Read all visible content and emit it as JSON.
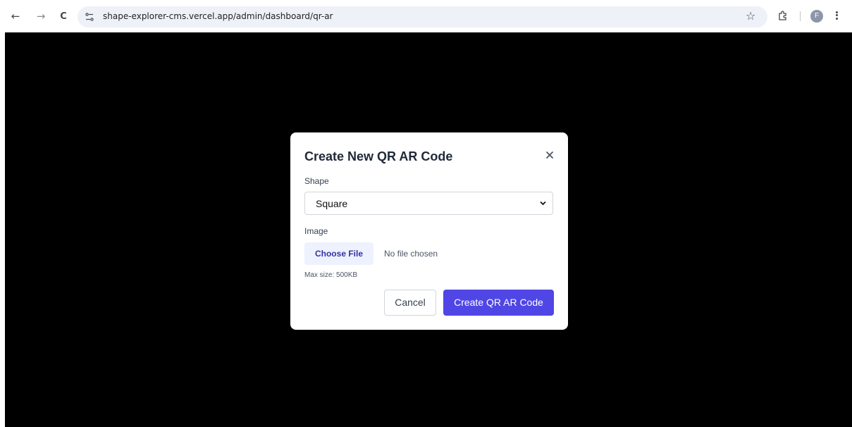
{
  "browser": {
    "url": "shape-explorer-cms.vercel.app/admin/dashboard/qr-ar",
    "profile_initial": "F",
    "icons": {
      "back": "arrow-left-icon",
      "forward": "arrow-right-icon",
      "reload": "reload-icon",
      "site_info": "tune-icon",
      "bookmark": "star-icon",
      "extensions": "puzzle-icon",
      "menu": "kebab-menu-icon"
    },
    "glyphs": {
      "back": "←",
      "forward": "→",
      "reload": "C",
      "bookmark": "☆"
    }
  },
  "modal": {
    "title": "Create New QR AR Code",
    "close_icon": "close-icon",
    "shape_label": "Shape",
    "shape_value": "Square",
    "image_label": "Image",
    "choose_file_label": "Choose File",
    "file_status": "No file chosen",
    "max_size": "Max size: 500KB",
    "cancel_label": "Cancel",
    "submit_label": "Create QR AR Code"
  },
  "colors": {
    "overlay": "#000000",
    "primary_button": "#4f46e5",
    "file_button_bg": "#eef2ff",
    "file_button_text": "#3730a3"
  }
}
